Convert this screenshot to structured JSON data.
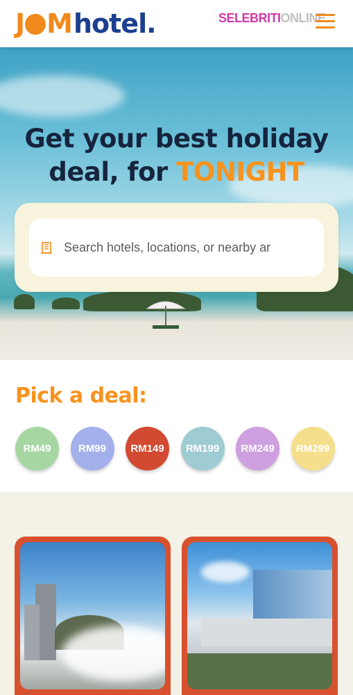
{
  "header": {
    "logo_jom": "J",
    "logo_om": "M",
    "logo_hotel": "hotel.",
    "partner_part1": "SELEBRITI",
    "partner_part2": "ONLINE"
  },
  "hero": {
    "title_line1": "Get your best holiday",
    "title_line2_prefix": "deal, for ",
    "title_highlight": "TONIGHT",
    "search_placeholder": "Search hotels, locations, or nearby ar"
  },
  "deals": {
    "title": "Pick a deal:",
    "items": [
      {
        "label": "RM49",
        "color": "#a6d7a3"
      },
      {
        "label": "RM99",
        "color": "#a3b0ec"
      },
      {
        "label": "RM149",
        "color": "#d24a31"
      },
      {
        "label": "RM199",
        "color": "#9fcbd3"
      },
      {
        "label": "RM249",
        "color": "#cfa0df"
      },
      {
        "label": "RM299",
        "color": "#f6df8c"
      }
    ]
  },
  "colors": {
    "accent": "#f7931e",
    "brand_blue": "#1d3f8f",
    "card_border": "#d8512e"
  }
}
